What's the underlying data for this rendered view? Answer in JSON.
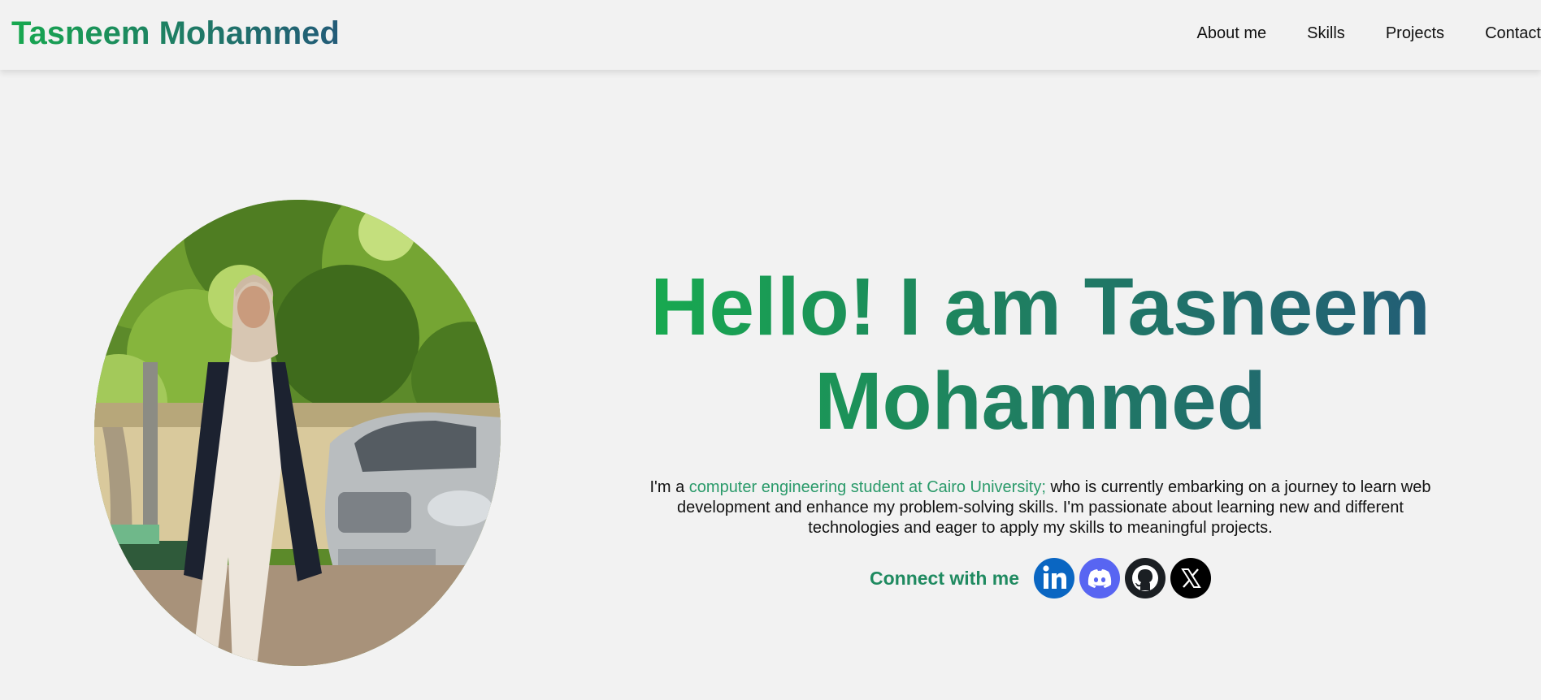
{
  "header": {
    "brand": "Tasneem Mohammed",
    "nav": [
      "About me",
      "Skills",
      "Projects",
      "Contact"
    ]
  },
  "hero": {
    "title_line1": "Hello! I am Tasneem",
    "title_line2": "Mohammed",
    "desc_prefix": "I'm a ",
    "desc_highlight": "computer engineering student at Cairo University;",
    "desc_rest": " who is currently embarking on a journey to learn web development and enhance my problem-solving skills. I'm passionate about learning new and different technologies and eager to apply my skills to meaningful projects.",
    "connect_label": "Connect with me"
  },
  "social_icons": [
    "linkedin-icon",
    "discord-icon",
    "github-icon",
    "x-icon"
  ],
  "colors": {
    "background": "#f2f2f2",
    "gradient_start": "#17ad4e",
    "gradient_end": "#235b78",
    "highlight_text": "#2a9a6a",
    "linkedin": "#0a66c2",
    "discord": "#5865f2",
    "github": "#1b1f23",
    "x": "#000000"
  }
}
